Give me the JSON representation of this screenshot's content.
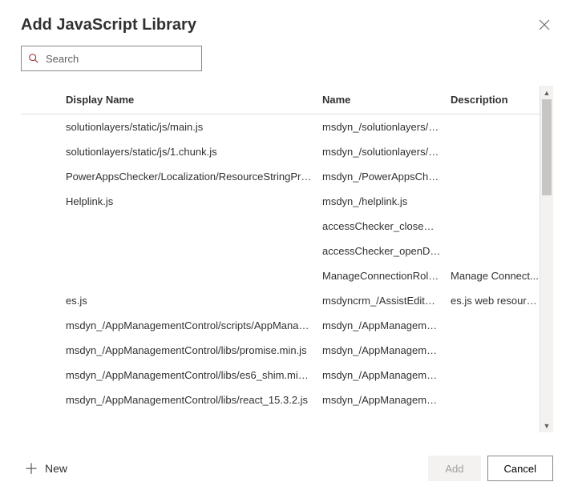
{
  "dialog": {
    "title": "Add JavaScript Library"
  },
  "search": {
    "placeholder": "Search",
    "value": ""
  },
  "table": {
    "columns": {
      "displayName": "Display Name",
      "name": "Name",
      "description": "Description"
    },
    "rows": [
      {
        "displayName": "solutionlayers/static/js/main.js",
        "name": "msdyn_/solutionlayers/sta...",
        "description": ""
      },
      {
        "displayName": "solutionlayers/static/js/1.chunk.js",
        "name": "msdyn_/solutionlayers/sta...",
        "description": ""
      },
      {
        "displayName": "PowerAppsChecker/Localization/ResourceStringProvid...",
        "name": "msdyn_/PowerAppsCheck...",
        "description": ""
      },
      {
        "displayName": "Helplink.js",
        "name": "msdyn_/helplink.js",
        "description": ""
      },
      {
        "displayName": "",
        "name": "accessChecker_closeDialo...",
        "description": ""
      },
      {
        "displayName": "",
        "name": "accessChecker_openDialo...",
        "description": ""
      },
      {
        "displayName": "",
        "name": "ManageConnectionRoles...",
        "description": "Manage Connect..."
      },
      {
        "displayName": "es.js",
        "name": "msdyncrm_/AssistEditCon...",
        "description": "es.js web resource."
      },
      {
        "displayName": "msdyn_/AppManagementControl/scripts/AppManage...",
        "name": "msdyn_/AppManagement...",
        "description": ""
      },
      {
        "displayName": "msdyn_/AppManagementControl/libs/promise.min.js",
        "name": "msdyn_/AppManagement...",
        "description": ""
      },
      {
        "displayName": "msdyn_/AppManagementControl/libs/es6_shim.min.js",
        "name": "msdyn_/AppManagement...",
        "description": ""
      },
      {
        "displayName": "msdyn_/AppManagementControl/libs/react_15.3.2.js",
        "name": "msdyn_/AppManagement...",
        "description": ""
      }
    ]
  },
  "footer": {
    "newLabel": "New",
    "addLabel": "Add",
    "cancelLabel": "Cancel"
  }
}
